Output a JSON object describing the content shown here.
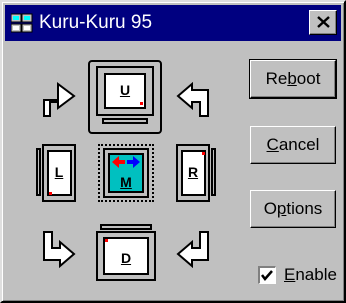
{
  "window": {
    "title": "Kuru-Kuru 95",
    "close_glyph": "×"
  },
  "monitors": {
    "up": "U",
    "left": "L",
    "middle": "M",
    "right": "R",
    "down": "D"
  },
  "buttons": {
    "reboot": {
      "pre": "Re",
      "mnemonic": "b",
      "post": "oot"
    },
    "cancel": {
      "pre": "",
      "mnemonic": "C",
      "post": "ancel"
    },
    "options": {
      "pre": "O",
      "mnemonic": "p",
      "post": "tions"
    }
  },
  "enable": {
    "pre": "",
    "mnemonic": "E",
    "post": "nable",
    "checked": true
  },
  "colors": {
    "titlebar": "#000080",
    "face": "#c0c0c0",
    "middle_screen": "#00c0c0",
    "arrow_red": "#ff0000",
    "arrow_blue": "#0000ff"
  }
}
